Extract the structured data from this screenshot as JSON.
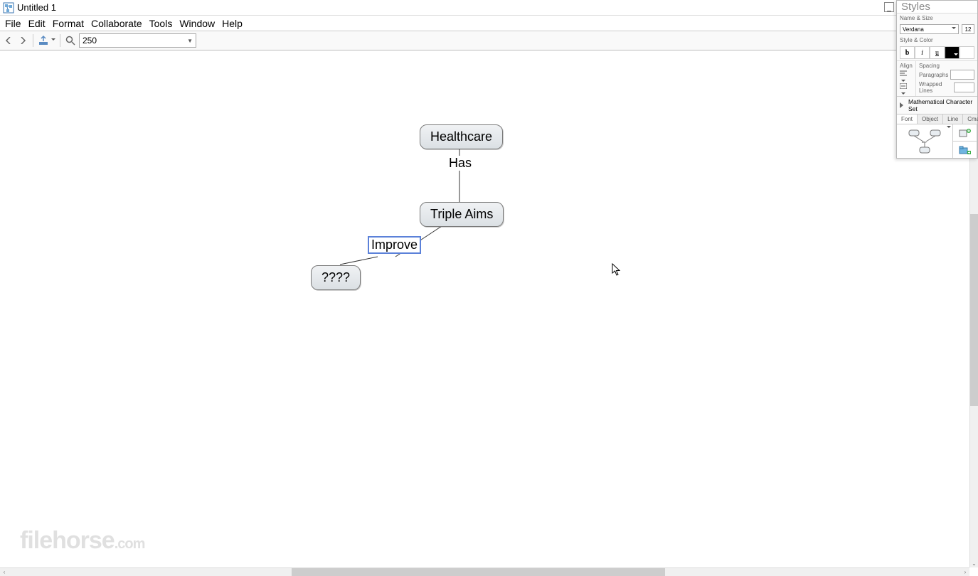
{
  "window": {
    "title": "Untitled 1"
  },
  "menus": [
    "File",
    "Edit",
    "Format",
    "Collaborate",
    "Tools",
    "Window",
    "Help"
  ],
  "toolbar": {
    "zoom_value": "250"
  },
  "cmap": {
    "node_healthcare": "Healthcare",
    "node_triple": "Triple Aims",
    "node_placeholder": "????",
    "link_has": "Has",
    "link_improve": "Improve"
  },
  "styles_panel": {
    "title": "Styles",
    "name_size_label": "Name & Size",
    "font_name": "Verdana",
    "font_size": "12",
    "style_color_label": "Style & Color",
    "bold": "b",
    "italic": "i",
    "underline": "u",
    "align_label": "Align",
    "spacing_label": "Spacing",
    "paragraphs_label": "Paragraphs",
    "wrapped_label": "Wrapped Lines",
    "mcs_label": "Mathematical Character Set",
    "tabs": [
      "Font",
      "Object",
      "Line",
      "Cmap"
    ]
  },
  "watermark": {
    "main": "filehorse",
    "com": ".com"
  }
}
